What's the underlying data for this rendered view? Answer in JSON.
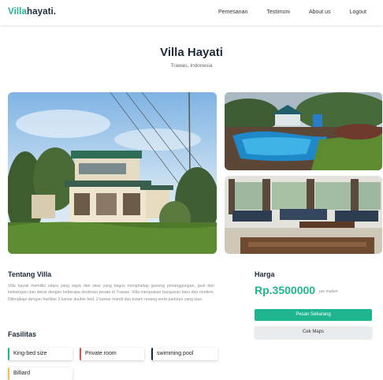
{
  "navbar": {
    "brand_part1": "Villa",
    "brand_part2": "hayati.",
    "links": [
      "Pemesanan",
      "Testimoni",
      "About us",
      "Logout"
    ]
  },
  "header": {
    "title": "Villa Hayati",
    "location": "Trawas, Indonesia"
  },
  "about": {
    "title": "Tentang Villa",
    "text": "Villa hayati memiliki udara yang sejuk dan view yang bagus menghadap gunung penanggungan, jauh dari kebisingan dan dekat dengan beberapa destinasi wisata di Trawas. Villa merupakan bangunan baru dan modern. Dilengkapi dengan fasilitas 3 kamar double bed, 2 kamar mandi dan kolam renang serta parkiran yang luas."
  },
  "facilities": {
    "title": "Fasilitas",
    "items": [
      "King-bed size",
      "Private room",
      "swimming pool",
      "Billiard"
    ]
  },
  "pricing": {
    "title": "Harga",
    "price": "Rp.3500000",
    "unit": "per malam",
    "book_label": "Pesan Sekarang",
    "map_label": "Cek Maps"
  },
  "colors": {
    "accent": "#1fb58f",
    "dark": "#1d2a3a"
  }
}
